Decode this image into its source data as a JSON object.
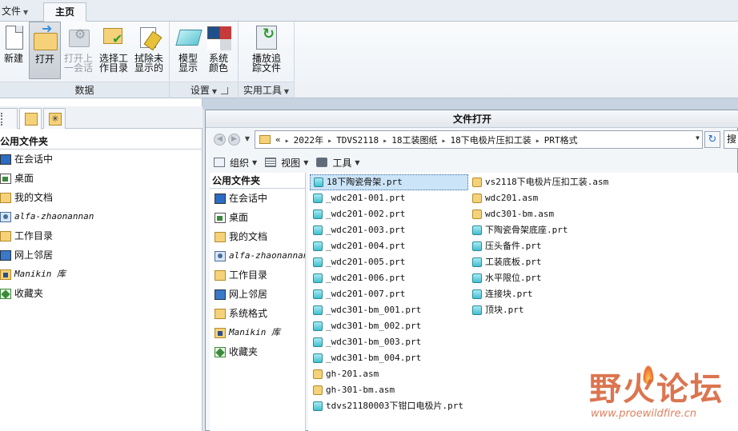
{
  "ribbon": {
    "tabs": [
      {
        "label": "文件",
        "dropdown": true
      },
      {
        "label": "主页",
        "active": true
      }
    ],
    "groups": [
      {
        "label": "数据",
        "buttons": [
          {
            "label": "新建",
            "icon": "new-file-icon"
          },
          {
            "label": "打开",
            "icon": "open-folder-icon",
            "pressed": true
          },
          {
            "label": "打开上\n一会话",
            "icon": "open-last-session-icon",
            "disabled": true
          },
          {
            "label": "选择工\n作目录",
            "icon": "select-working-directory-icon"
          },
          {
            "label": "拭除未\n显示的",
            "icon": "erase-not-displayed-icon"
          }
        ]
      },
      {
        "label": "设置",
        "buttons": [
          {
            "label": "模型\n显示",
            "icon": "model-display-icon"
          },
          {
            "label": "系统\n颜色",
            "icon": "system-colors-icon"
          }
        ]
      },
      {
        "label": "实用工具",
        "buttons": [
          {
            "label": "播放追\n踪文件",
            "icon": "play-trail-file-icon"
          }
        ]
      }
    ]
  },
  "navigator": {
    "tabs": [
      "tree-icon",
      "folders-icon",
      "favorites-icon"
    ],
    "section_title": "公用文件夹",
    "items": [
      {
        "label": "在会话中",
        "icon": "monitor-icon"
      },
      {
        "label": "桌面",
        "icon": "desktop-icon"
      },
      {
        "label": "我的文档",
        "icon": "documents-folder-icon"
      },
      {
        "label": "alfa-zhaonannan",
        "icon": "user-folder-icon",
        "mono": true
      },
      {
        "label": "工作目录",
        "icon": "working-directory-icon"
      },
      {
        "label": "网上邻居",
        "icon": "network-icon"
      },
      {
        "label": "Manikin 库",
        "icon": "manikin-library-icon",
        "mono": true
      },
      {
        "label": "收藏夹",
        "icon": "favorites-icon"
      }
    ]
  },
  "dialog": {
    "title": "文件打开",
    "breadcrumb": [
      "2022年",
      "TDVS2118",
      "18工装图纸",
      "18下电极片压扣工装",
      "PRT格式"
    ],
    "breadcrumb_prefix": "«",
    "search_placeholder": "搜",
    "toolbar": [
      {
        "label": "组织",
        "icon": "organize-icon"
      },
      {
        "label": "视图",
        "icon": "views-icon"
      },
      {
        "label": "工具",
        "icon": "tools-icon"
      }
    ],
    "left_section_title": "公用文件夹",
    "left_items": [
      {
        "label": "在会话中",
        "icon": "monitor-icon"
      },
      {
        "label": "桌面",
        "icon": "desktop-icon"
      },
      {
        "label": "我的文档",
        "icon": "documents-folder-icon"
      },
      {
        "label": "alfa-zhaonannan",
        "icon": "user-folder-icon",
        "mono": true
      },
      {
        "label": "工作目录",
        "icon": "working-directory-icon"
      },
      {
        "label": "网上邻居",
        "icon": "network-icon"
      },
      {
        "label": "系统格式",
        "icon": "system-formats-icon"
      },
      {
        "label": "Manikin 库",
        "icon": "manikin-library-icon",
        "mono": true
      },
      {
        "label": "收藏夹",
        "icon": "favorites-icon"
      }
    ],
    "files_col1": [
      {
        "name": "18下陶瓷骨架.prt",
        "type": "prt",
        "selected": true
      },
      {
        "name": "_wdc201-001.prt",
        "type": "prt"
      },
      {
        "name": "_wdc201-002.prt",
        "type": "prt"
      },
      {
        "name": "_wdc201-003.prt",
        "type": "prt"
      },
      {
        "name": "_wdc201-004.prt",
        "type": "prt"
      },
      {
        "name": "_wdc201-005.prt",
        "type": "prt"
      },
      {
        "name": "_wdc201-006.prt",
        "type": "prt"
      },
      {
        "name": "_wdc201-007.prt",
        "type": "prt"
      },
      {
        "name": "_wdc301-bm_001.prt",
        "type": "prt"
      },
      {
        "name": "_wdc301-bm_002.prt",
        "type": "prt"
      },
      {
        "name": "_wdc301-bm_003.prt",
        "type": "prt"
      },
      {
        "name": "_wdc301-bm_004.prt",
        "type": "prt"
      },
      {
        "name": "gh-201.asm",
        "type": "asm"
      },
      {
        "name": "gh-301-bm.asm",
        "type": "asm"
      },
      {
        "name": "tdvs21180003下钳口电极片.prt",
        "type": "prt"
      }
    ],
    "files_col2": [
      {
        "name": "vs2118下电极片压扣工装.asm",
        "type": "asm"
      },
      {
        "name": "wdc201.asm",
        "type": "asm"
      },
      {
        "name": "wdc301-bm.asm",
        "type": "asm"
      },
      {
        "name": "下陶瓷骨架底座.prt",
        "type": "prt"
      },
      {
        "name": "压头备件.prt",
        "type": "prt"
      },
      {
        "name": "工装底板.prt",
        "type": "prt"
      },
      {
        "name": "水平限位.prt",
        "type": "prt"
      },
      {
        "name": "连接块.prt",
        "type": "prt"
      },
      {
        "name": "顶块.prt",
        "type": "prt"
      }
    ]
  },
  "watermark": {
    "title": "野火论坛",
    "url": "www.proewildfire.cn"
  }
}
